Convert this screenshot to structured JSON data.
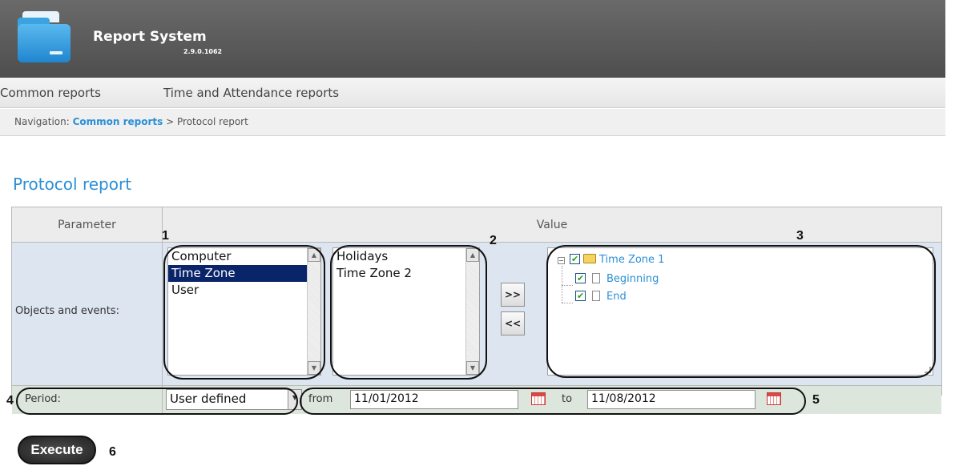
{
  "header": {
    "title": "Report System",
    "version": "2.9.0.1062"
  },
  "menu": {
    "items": [
      "Common reports",
      "Time and Attendance reports"
    ]
  },
  "breadcrumb": {
    "prefix": "Navigation: ",
    "link": "Common reports",
    "separator": " > ",
    "current": "Protocol report"
  },
  "page_title": "Protocol report",
  "table": {
    "col_parameter": "Parameter",
    "col_value": "Value",
    "objects_label": "Objects and events:",
    "period_label": "Period:"
  },
  "object_types": {
    "items": [
      "Computer",
      "Time Zone",
      "User"
    ],
    "selected": "Time Zone"
  },
  "objects": {
    "items": [
      "Holidays",
      "Time Zone 2"
    ]
  },
  "buttons": {
    "add": ">>",
    "remove": "<<",
    "execute": "Execute"
  },
  "tree": {
    "root": {
      "label": "Time Zone 1",
      "checked": true
    },
    "children": [
      {
        "label": "Beginning",
        "checked": true
      },
      {
        "label": "End",
        "checked": true
      }
    ]
  },
  "period": {
    "mode": "User defined",
    "from_label": "from",
    "from": "11/01/2012",
    "to_label": "to",
    "to": "11/08/2012"
  },
  "callouts": [
    "1",
    "2",
    "3",
    "4",
    "5",
    "6"
  ],
  "colors": {
    "accent": "#2b8fd6",
    "header_bg": "#5a5a5a",
    "selection": "#0a246a"
  },
  "icons": [
    "report-folder-icon",
    "collapse-icon",
    "checkbox-icon",
    "folder-icon",
    "document-icon",
    "calendar-icon",
    "dropdown-arrow-icon",
    "scroll-up-icon",
    "scroll-down-icon"
  ]
}
